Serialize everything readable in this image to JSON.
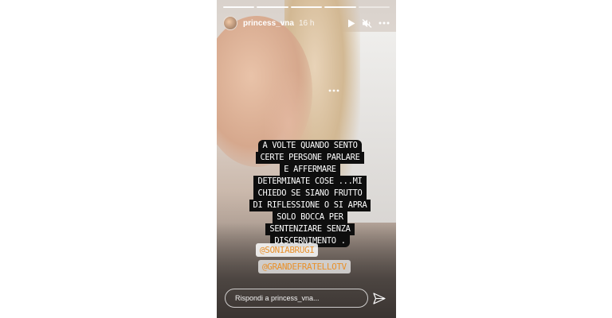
{
  "story": {
    "progress": {
      "segments": 5,
      "current": 4
    },
    "user": {
      "username": "princess_vna",
      "time": "16 h"
    },
    "header_icons": [
      "play-icon",
      "muted-icon",
      "more-icon"
    ],
    "caption_lines": [
      "A VOLTE QUANDO SENTO",
      "CERTE PERSONE PARLARE",
      "E AFFERMARE",
      "DETERMINATE COSE ...MI",
      "CHIEDO SE SIANO FRUTTO",
      "DI RIFLESSIONE O SI APRA",
      "SOLO BOCCA PER",
      "SENTENZIARE SENZA",
      "DISCERNIMENTO ."
    ],
    "mentions": [
      "@SONIABRUGI",
      "@GRANDEFRATELLOTV"
    ],
    "reply": {
      "placeholder": "Rispondi a princess_vna..."
    },
    "colors": {
      "caption_bg": "#0e0e0e",
      "mention_text": "#e8912c"
    }
  }
}
